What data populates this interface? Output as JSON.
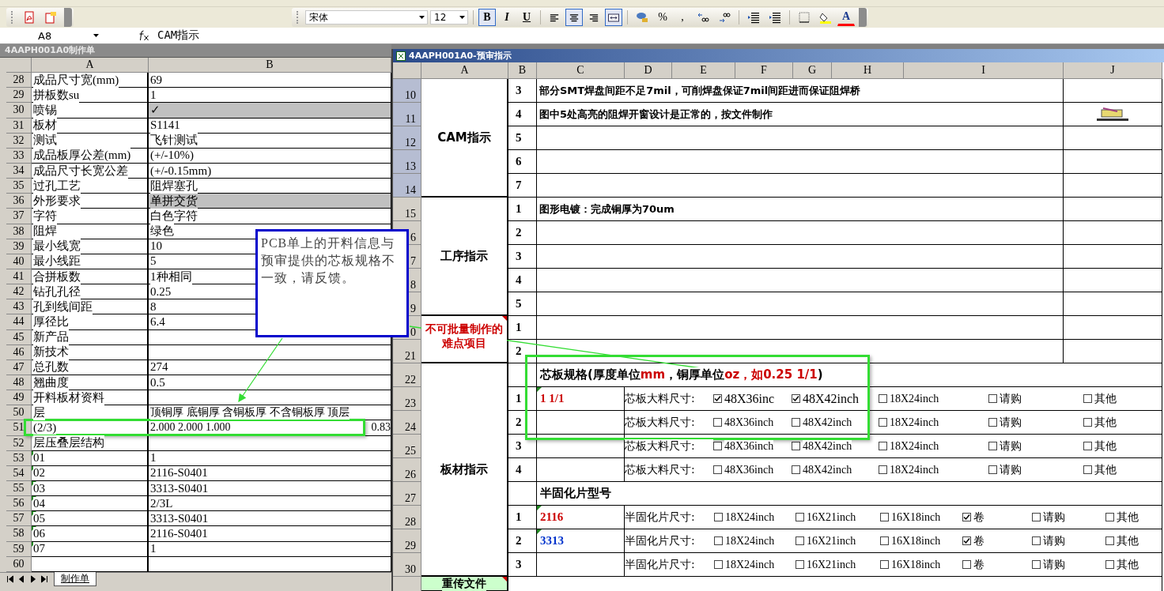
{
  "toolbar": {
    "font": "宋体",
    "size": "12",
    "format_buttons": [
      {
        "label": "B",
        "pressed": true
      },
      {
        "label": "I",
        "pressed": false
      },
      {
        "label": "U",
        "pressed": false
      }
    ],
    "align_buttons": [
      {
        "selected": false
      },
      {
        "selected": true
      },
      {
        "selected": false
      }
    ],
    "merge_pressed": true,
    "number_symbols": [
      "%",
      ","
    ],
    "font_color_label": "A"
  },
  "formula_bar": {
    "cell": "A8",
    "content": "CAM指示"
  },
  "left_window": {
    "title": "4AAPH001A0制作单",
    "columns": [
      "A",
      "B"
    ],
    "rows": [
      {
        "row": "28",
        "a": "成品尺寸宽(mm)",
        "b": "69",
        "shaded": false,
        "flag": false
      },
      {
        "row": "29",
        "a": "拼板数su",
        "b": "1",
        "shaded": false,
        "flag": false
      },
      {
        "row": "30",
        "a": "喷锡",
        "b": "✓",
        "shaded": true,
        "flag": false
      },
      {
        "row": "31",
        "a": "板材",
        "b": "S1141",
        "shaded": false,
        "flag": false
      },
      {
        "row": "32",
        "a": "测试",
        "b": "飞针测试",
        "shaded": false,
        "flag": false
      },
      {
        "row": "33",
        "a": "成品板厚公差(mm)",
        "b": "(+/-10%)",
        "shaded": false,
        "flag": false
      },
      {
        "row": "34",
        "a": "成品尺寸长宽公差",
        "b": "(+/-0.15mm)",
        "shaded": false,
        "flag": false
      },
      {
        "row": "35",
        "a": "过孔工艺",
        "b": "阻焊塞孔",
        "shaded": false,
        "flag": false
      },
      {
        "row": "36",
        "a": "外形要求",
        "b": "单拼交货",
        "shaded": true,
        "flag": false
      },
      {
        "row": "37",
        "a": "字符",
        "b": "白色字符",
        "shaded": false,
        "flag": false
      },
      {
        "row": "38",
        "a": "阻焊",
        "b": "绿色",
        "shaded": false,
        "flag": false
      },
      {
        "row": "39",
        "a": "最小线宽",
        "b": "10",
        "shaded": false,
        "flag": false
      },
      {
        "row": "40",
        "a": "最小线距",
        "b": "5",
        "shaded": false,
        "flag": false
      },
      {
        "row": "41",
        "a": "合拼板数",
        "b": "1种相同",
        "shaded": false,
        "flag": false
      },
      {
        "row": "42",
        "a": "钻孔孔径",
        "b": "0.25",
        "shaded": false,
        "flag": false
      },
      {
        "row": "43",
        "a": "孔到线间距",
        "b": "8",
        "shaded": false,
        "flag": false
      },
      {
        "row": "44",
        "a": "厚径比",
        "b": "6.4",
        "shaded": false,
        "flag": false
      },
      {
        "row": "45",
        "a": "新产品",
        "shaded": false,
        "flag": false
      },
      {
        "row": "46",
        "a": "新技术",
        "shaded": false,
        "flag": false
      },
      {
        "row": "47",
        "a": "总孔数",
        "b": "274",
        "shaded": false,
        "flag": false
      },
      {
        "row": "48",
        "a": "翘曲度",
        "b": "0.5",
        "shaded": false,
        "flag": false
      },
      {
        "row": "49",
        "a": "开料板材资料",
        "shaded": false,
        "flag": false
      },
      {
        "row": "50",
        "a": "层",
        "b": "顶铜厚  底铜厚  含铜板厚  不含铜板厚  顶层",
        "shaded": false,
        "flag": false
      },
      {
        "row": "51",
        "a": "(2/3)",
        "b": "2.000  2.000   1.000",
        "b_end": "0.83",
        "shaded": false,
        "flag": false
      },
      {
        "row": "52",
        "a": "层压叠层结构",
        "shaded": false,
        "flag": false
      },
      {
        "row": "53",
        "a": "01",
        "b": "1",
        "shaded": false,
        "flag": true
      },
      {
        "row": "54",
        "a": "02",
        "b": "2116-S0401",
        "shaded": false,
        "flag": true
      },
      {
        "row": "55",
        "a": "03",
        "b": "3313-S0401",
        "shaded": false,
        "flag": true
      },
      {
        "row": "56",
        "a": "04",
        "b": "2/3L",
        "shaded": false,
        "flag": true
      },
      {
        "row": "57",
        "a": "05",
        "b": "3313-S0401",
        "shaded": false,
        "flag": true
      },
      {
        "row": "58",
        "a": "06",
        "b": "2116-S0401",
        "shaded": false,
        "flag": true
      },
      {
        "row": "59",
        "a": "07",
        "b": "1",
        "shaded": false,
        "flag": true
      },
      {
        "row": "60",
        "shaded": false,
        "flag": false
      }
    ],
    "sheet_tabs": [
      {
        "label": "制作单",
        "selected": true
      }
    ]
  },
  "right_window": {
    "title": "4AAPH001A0-预审指示",
    "columns": [
      "A",
      "B",
      "C",
      "D",
      "E",
      "F",
      "G",
      "H",
      "I",
      "J"
    ],
    "sections": [
      {
        "label": "CAM指示",
        "kind": "normal",
        "rows": [
          {
            "header": "10",
            "selected": true,
            "kind": "text",
            "num": "3",
            "text": "部分SMT焊盘间距不足7mil，可削焊盘保证7mil间距进而保证阻焊桥"
          },
          {
            "header": "11",
            "selected": true,
            "kind": "text",
            "num": "4",
            "text": "图中5处高亮的阻焊开窗设计是正常的，按文件制作",
            "attachment": true
          },
          {
            "header": "12",
            "selected": true,
            "kind": "text",
            "num": "5"
          },
          {
            "header": "13",
            "selected": true,
            "kind": "text",
            "num": "6"
          },
          {
            "header": "14",
            "selected": true,
            "kind": "text",
            "num": "7"
          }
        ]
      },
      {
        "label": "工序指示",
        "kind": "normal",
        "rows": [
          {
            "header": "15",
            "selected": false,
            "kind": "text",
            "num": "1",
            "text": "图形电镀：完成铜厚为70um"
          },
          {
            "header": "6",
            "selected": false,
            "kind": "text",
            "num": "2"
          },
          {
            "header": "7",
            "selected": false,
            "kind": "text",
            "num": "3"
          },
          {
            "header": "8",
            "selected": false,
            "kind": "text",
            "num": "4"
          },
          {
            "header": "9",
            "selected": false,
            "kind": "text",
            "num": "5"
          }
        ]
      },
      {
        "label": "不可批量制作的难点项目",
        "kind": "alert",
        "rows": [
          {
            "header": "0",
            "selected": false,
            "kind": "text",
            "num": "1"
          },
          {
            "header": "21",
            "selected": false,
            "kind": "text",
            "num": "2"
          }
        ]
      },
      {
        "label": "板材指示",
        "kind": "normal",
        "rows": [
          {
            "header": "22",
            "selected": false,
            "kind": "heading",
            "segments": [
              {
                "text": "芯板规格(厚度单位",
                "emphasis": false
              },
              {
                "text": "mm",
                "emphasis": true
              },
              {
                "text": "，铜厚单位",
                "emphasis": false
              },
              {
                "text": "oz，如0.25 1/1",
                "emphasis": true
              },
              {
                "text": ")",
                "emphasis": false
              }
            ]
          },
          {
            "header": "23",
            "selected": false,
            "kind": "core",
            "num": "1",
            "value": "1 1/1",
            "color": "#cc0000",
            "flag": true,
            "label": "芯板大料尺寸:",
            "options": [
              {
                "label": "48X36inc",
                "checked": true
              },
              {
                "label": "48X42inch",
                "checked": true
              },
              {
                "label": "18X24inch",
                "checked": false
              },
              {
                "label": "请购",
                "checked": false
              },
              {
                "label": "其他",
                "checked": false
              }
            ]
          },
          {
            "header": "24",
            "selected": false,
            "kind": "core",
            "num": "2",
            "label": "芯板大料尺寸:",
            "options": [
              {
                "label": "48X36inch",
                "checked": false
              },
              {
                "label": "48X42inch",
                "checked": false
              },
              {
                "label": "18X24inch",
                "checked": false
              },
              {
                "label": "请购",
                "checked": false
              },
              {
                "label": "其他",
                "checked": false
              }
            ]
          },
          {
            "header": "25",
            "selected": false,
            "kind": "core",
            "num": "3",
            "label": "芯板大料尺寸:",
            "options": [
              {
                "label": "48X36inch",
                "checked": false
              },
              {
                "label": "48X42inch",
                "checked": false
              },
              {
                "label": "18X24inch",
                "checked": false
              },
              {
                "label": "请购",
                "checked": false
              },
              {
                "label": "其他",
                "checked": false
              }
            ]
          },
          {
            "header": "26",
            "selected": false,
            "kind": "core",
            "num": "4",
            "label": "芯板大料尺寸:",
            "options": [
              {
                "label": "48X36inch",
                "checked": false
              },
              {
                "label": "48X42inch",
                "checked": false
              },
              {
                "label": "18X24inch",
                "checked": false
              },
              {
                "label": "请购",
                "checked": false
              },
              {
                "label": "其他",
                "checked": false
              }
            ]
          },
          {
            "header": "27",
            "selected": false,
            "kind": "heading",
            "segments": [
              {
                "text": "半固化片型号",
                "emphasis": false
              }
            ]
          },
          {
            "header": "28",
            "selected": false,
            "kind": "prepreg",
            "num": "1",
            "value": "2116",
            "color": "#cc0000",
            "flag": true,
            "label": "半固化片尺寸:",
            "options": [
              {
                "label": "18X24inch",
                "checked": false
              },
              {
                "label": "16X21inch",
                "checked": false
              },
              {
                "label": "16X18inch",
                "checked": false
              },
              {
                "label": "卷",
                "checked": true
              },
              {
                "label": "请购",
                "checked": false
              },
              {
                "label": "其他",
                "checked": false
              }
            ]
          },
          {
            "header": "29",
            "selected": false,
            "kind": "prepreg",
            "num": "2",
            "value": "3313",
            "color": "#0033cc",
            "flag": true,
            "label": "半固化片尺寸:",
            "options": [
              {
                "label": "18X24inch",
                "checked": false
              },
              {
                "label": "16X21inch",
                "checked": false
              },
              {
                "label": "16X18inch",
                "checked": false
              },
              {
                "label": "卷",
                "checked": true
              },
              {
                "label": "请购",
                "checked": false
              },
              {
                "label": "其他",
                "checked": false
              }
            ]
          },
          {
            "header": "30",
            "selected": false,
            "kind": "prepreg",
            "num": "3",
            "label": "半固化片尺寸:",
            "options": [
              {
                "label": "18X24inch",
                "checked": false
              },
              {
                "label": "16X21inch",
                "checked": false
              },
              {
                "label": "16X18inch",
                "checked": false
              },
              {
                "label": "卷",
                "checked": false
              },
              {
                "label": "请购",
                "checked": false
              },
              {
                "label": "其他",
                "checked": false
              }
            ]
          }
        ]
      },
      {
        "label": "重传文件",
        "kind": "highlight",
        "rows": [
          {
            "selected": false,
            "kind": "blank"
          }
        ]
      }
    ]
  },
  "callout": {
    "text": "PCB单上的开料信息与预审提供的芯板规格不一致，请反馈。"
  }
}
